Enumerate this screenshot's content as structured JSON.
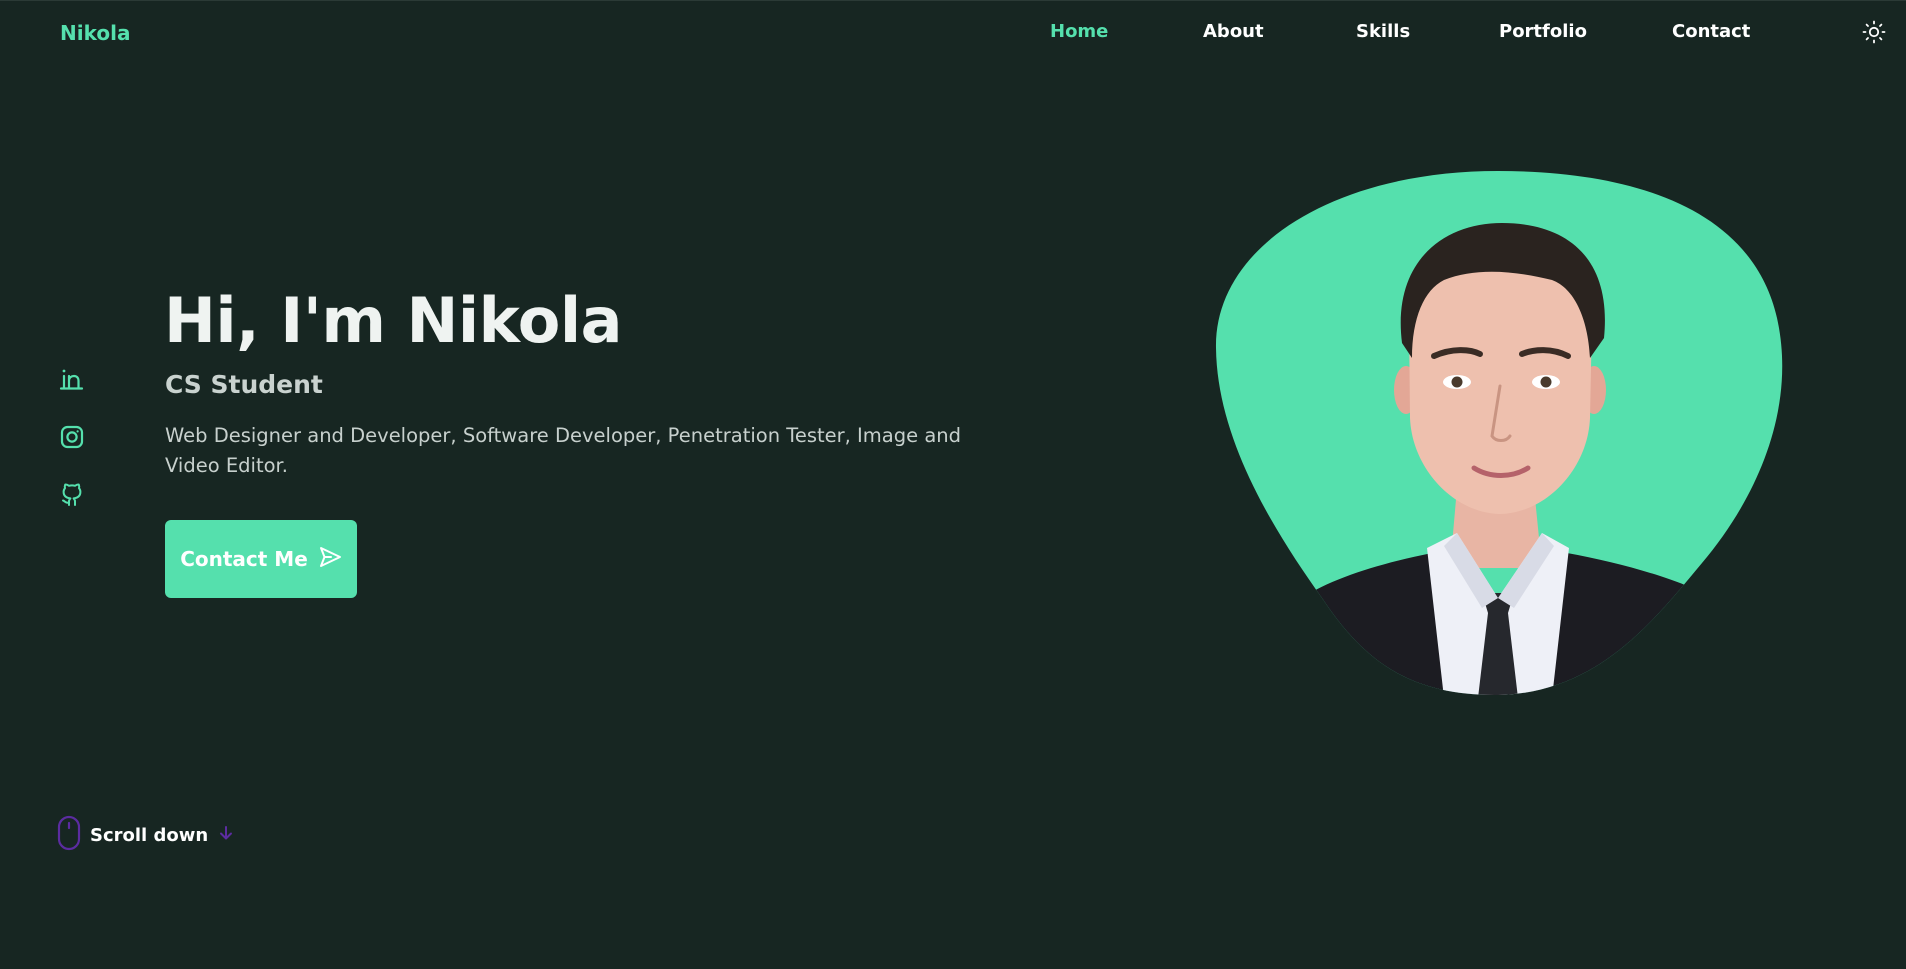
{
  "header": {
    "logo": "Nikola",
    "nav": [
      {
        "label": "Home",
        "active": true
      },
      {
        "label": "About",
        "active": false
      },
      {
        "label": "Skills",
        "active": false
      },
      {
        "label": "Portfolio",
        "active": false
      },
      {
        "label": "Contact",
        "active": false
      }
    ],
    "theme_toggle_icon": "sun-icon"
  },
  "social": [
    {
      "icon": "linkedin-icon"
    },
    {
      "icon": "instagram-icon"
    },
    {
      "icon": "github-icon"
    }
  ],
  "hero": {
    "title": "Hi, I'm Nikola",
    "subtitle": "CS Student",
    "description": "Web Designer and Developer, Software Developer, Penetration Tester, Image and Video Editor.",
    "cta_label": "Contact Me",
    "cta_icon": "send-icon"
  },
  "scroll": {
    "label": "Scroll down",
    "mouse_icon": "mouse-icon",
    "arrow_icon": "arrow-down-icon"
  },
  "colors": {
    "background": "#172622",
    "accent": "#55e0ad",
    "scroll_accent": "#5b2ca0"
  }
}
